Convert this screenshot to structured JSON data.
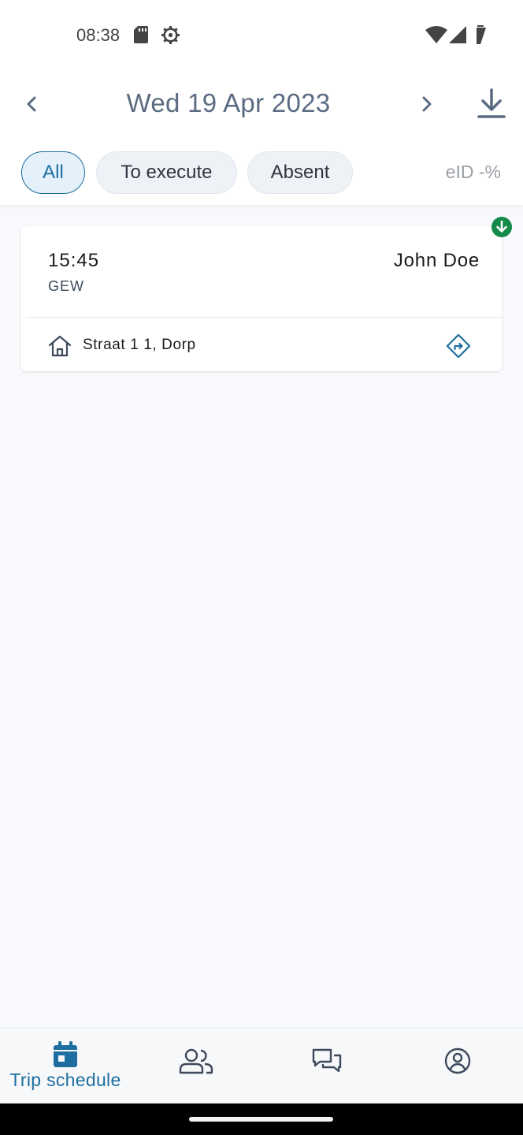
{
  "status_bar": {
    "time": "08:38"
  },
  "header": {
    "date": "Wed 19 Apr 2023"
  },
  "filters": {
    "items": [
      {
        "label": "All",
        "active": true
      },
      {
        "label": "To execute",
        "active": false
      },
      {
        "label": "Absent",
        "active": false
      }
    ],
    "eid": "eID -%"
  },
  "trips": [
    {
      "time": "15:45",
      "code": "GEW",
      "name": "John Doe",
      "address": "Straat 1 1, Dorp",
      "status_color": "#138a4a"
    }
  ],
  "bottom_nav": {
    "items": [
      {
        "label": "Trip schedule",
        "icon": "calendar-icon",
        "active": true
      },
      {
        "label": "",
        "icon": "people-icon",
        "active": false
      },
      {
        "label": "",
        "icon": "chat-icon",
        "active": false
      },
      {
        "label": "",
        "icon": "profile-icon",
        "active": false
      }
    ]
  },
  "colors": {
    "accent": "#1e6f9f",
    "title": "#5a6b82",
    "background": "#f7f9fc"
  }
}
